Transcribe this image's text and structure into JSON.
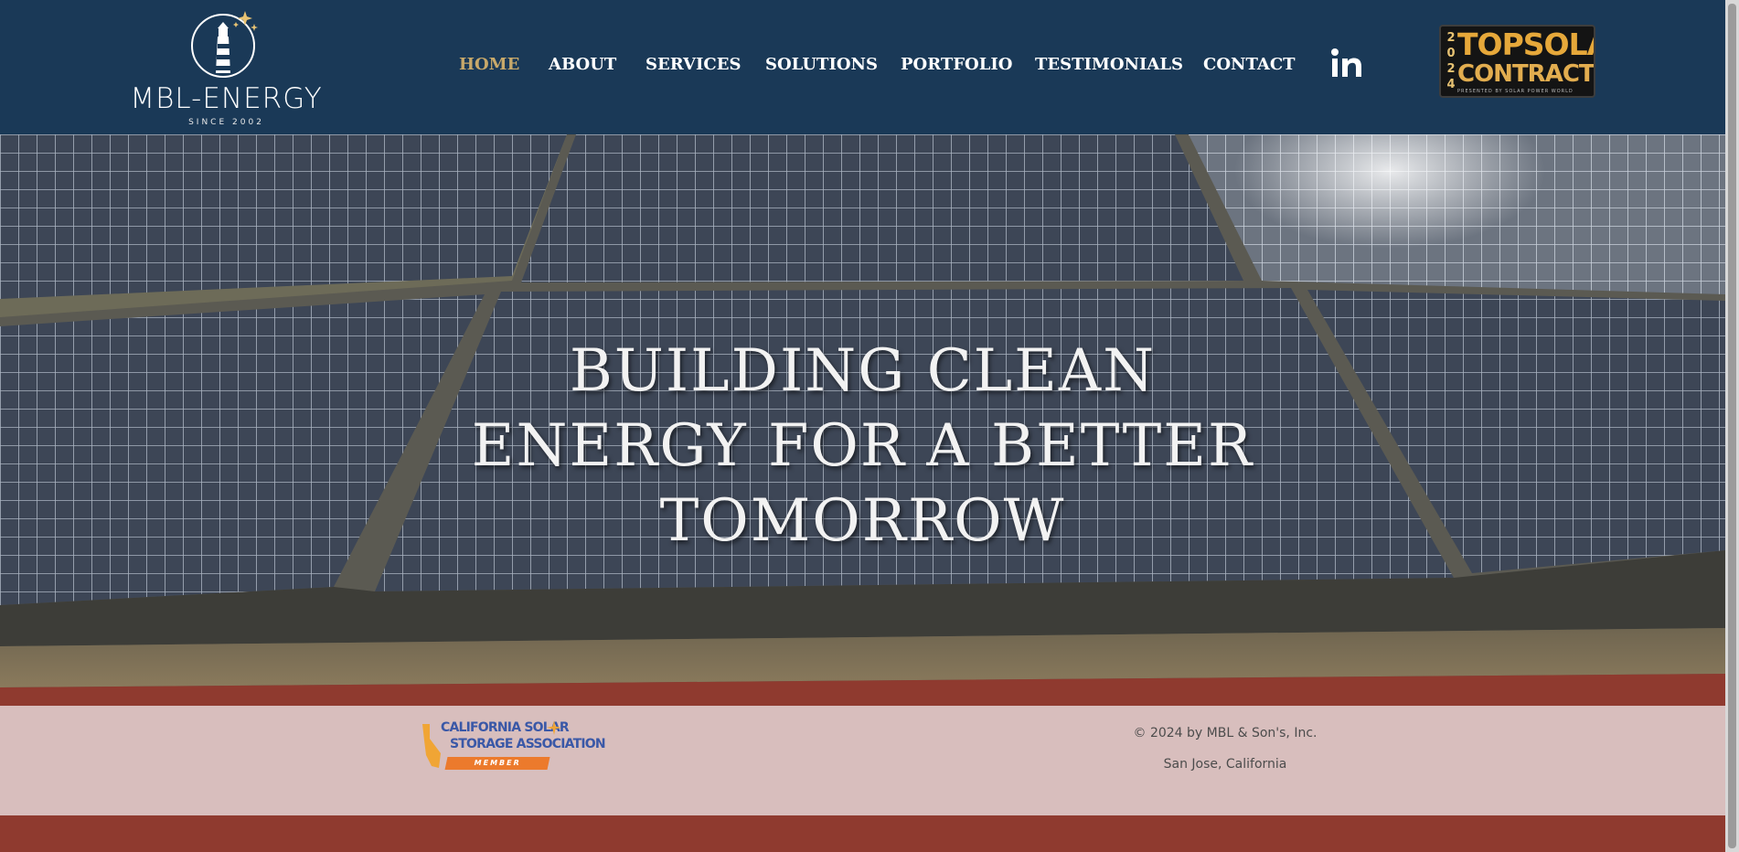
{
  "brand": {
    "name": "MBL-ENERGY",
    "tagline": "SINCE 2002"
  },
  "nav": {
    "items": [
      {
        "label": "HOME",
        "active": true
      },
      {
        "label": "ABOUT",
        "active": false
      },
      {
        "label": "SERVICES",
        "active": false
      },
      {
        "label": "SOLUTIONS",
        "active": false
      },
      {
        "label": "PORTFOLIO",
        "active": false
      },
      {
        "label": "TESTIMONIALS",
        "active": false
      },
      {
        "label": "CONTACT",
        "active": false
      }
    ],
    "social_icon": "linkedin-icon"
  },
  "award": {
    "year": "2024",
    "line1": "TOPSOLAR",
    "line2": "CONTRACTORS",
    "line3": "PRESENTED BY SOLAR POWER WORLD"
  },
  "hero": {
    "title_lines": [
      "BUILDING CLEAN",
      "ENERGY FOR A BETTER",
      "TOMORROW"
    ]
  },
  "footer": {
    "badge_line1": "CALIFORNIA SOLAR",
    "badge_line2": "STORAGE ASSOCIATION",
    "badge_member": "MEMBER",
    "copyright": "© 2024 by MBL & Son's, Inc.",
    "location": "San Jose, California"
  },
  "colors": {
    "header_bg": "#1a3957",
    "nav_active": "#c8a96a",
    "nav_text": "#ffffff",
    "footer_bg": "#dec8c8",
    "track_red": "#8f3a2f"
  }
}
